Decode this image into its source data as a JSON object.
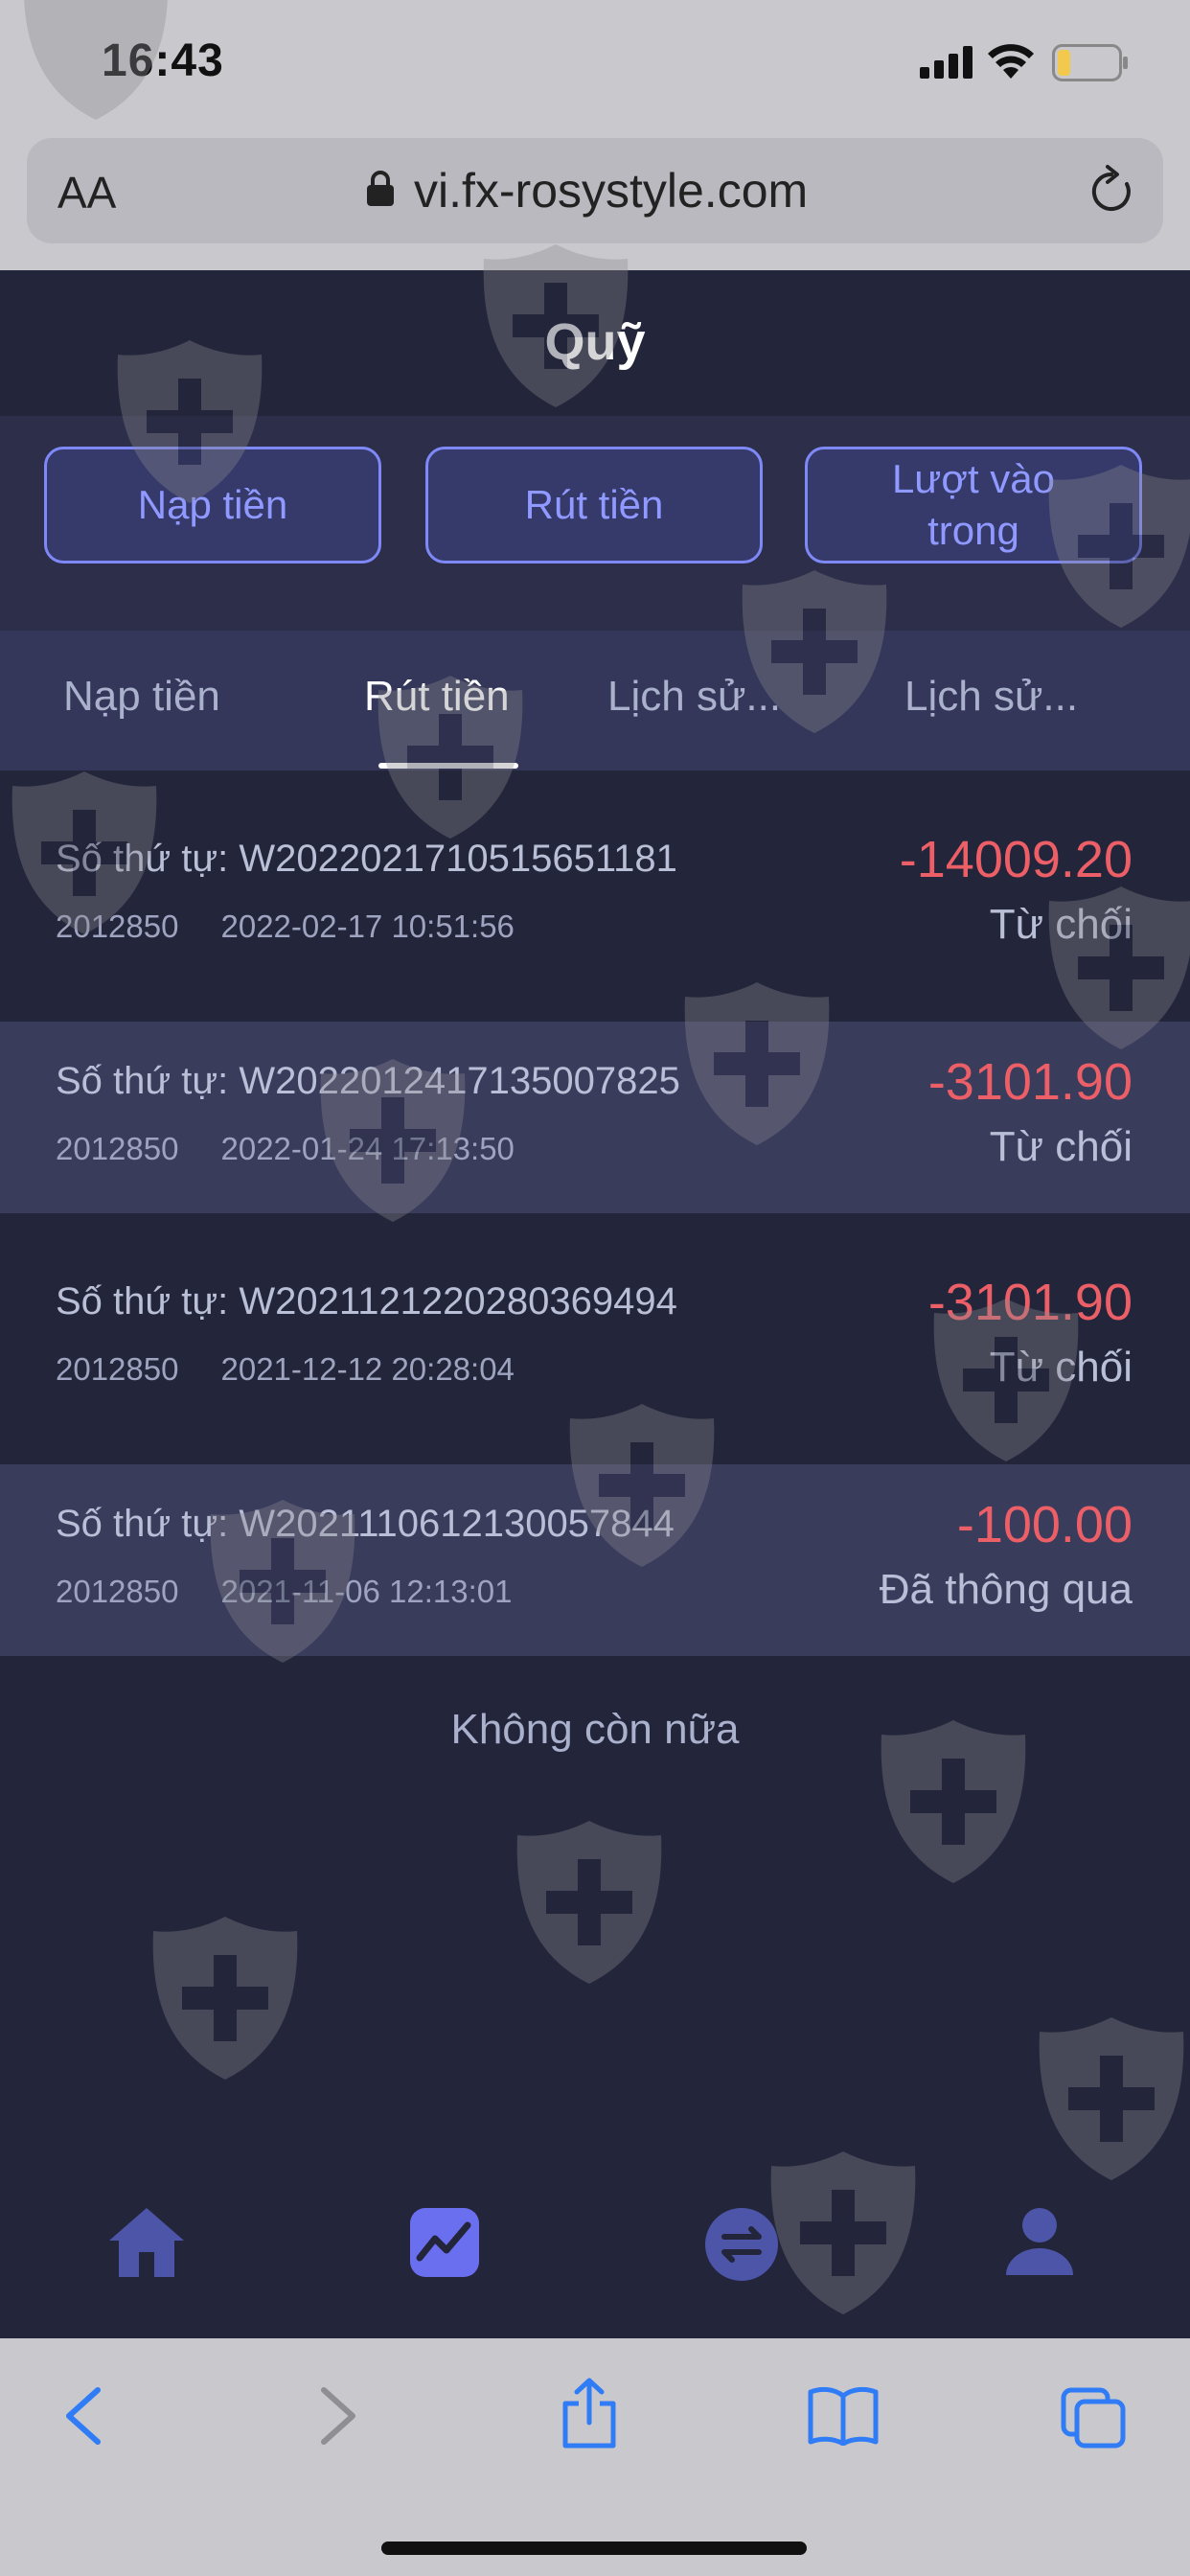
{
  "status_bar": {
    "time": "16:43"
  },
  "browser": {
    "aa_label": "AA",
    "url": "vi.fx-rosystyle.com"
  },
  "page": {
    "title": "Quỹ"
  },
  "actions": [
    {
      "label": "Nạp tiền"
    },
    {
      "label": "Rút tiền"
    },
    {
      "label": "Lượt vào trong"
    }
  ],
  "tabs": [
    {
      "label": "Nạp tiền",
      "active": false
    },
    {
      "label": "Rút tiền",
      "active": true
    },
    {
      "label": "Lịch sử...",
      "active": false
    },
    {
      "label": "Lịch sử...",
      "active": false
    }
  ],
  "order_prefix": "Số thứ tự:",
  "records": [
    {
      "order_no": "W2022021710515651181",
      "account": "2012850",
      "datetime": "2022-02-17 10:51:56",
      "amount": "-14009.20",
      "status": "Từ chối"
    },
    {
      "order_no": "W2022012417135007825",
      "account": "2012850",
      "datetime": "2022-01-24 17:13:50",
      "amount": "-3101.90",
      "status": "Từ chối"
    },
    {
      "order_no": "W2021121220280369494",
      "account": "2012850",
      "datetime": "2021-12-12 20:28:04",
      "amount": "-3101.90",
      "status": "Từ chối"
    },
    {
      "order_no": "W2021110612130057844",
      "account": "2012850",
      "datetime": "2021-11-06 12:13:01",
      "amount": "-100.00",
      "status": "Đã thông qua"
    }
  ],
  "footer_text": "Không còn nữa",
  "bottom_nav": [
    "home-icon",
    "chart-icon",
    "exchange-icon",
    "user-icon"
  ],
  "colors": {
    "accent": "#7e88f6",
    "negative": "#ec5f67",
    "background": "#23253a"
  }
}
